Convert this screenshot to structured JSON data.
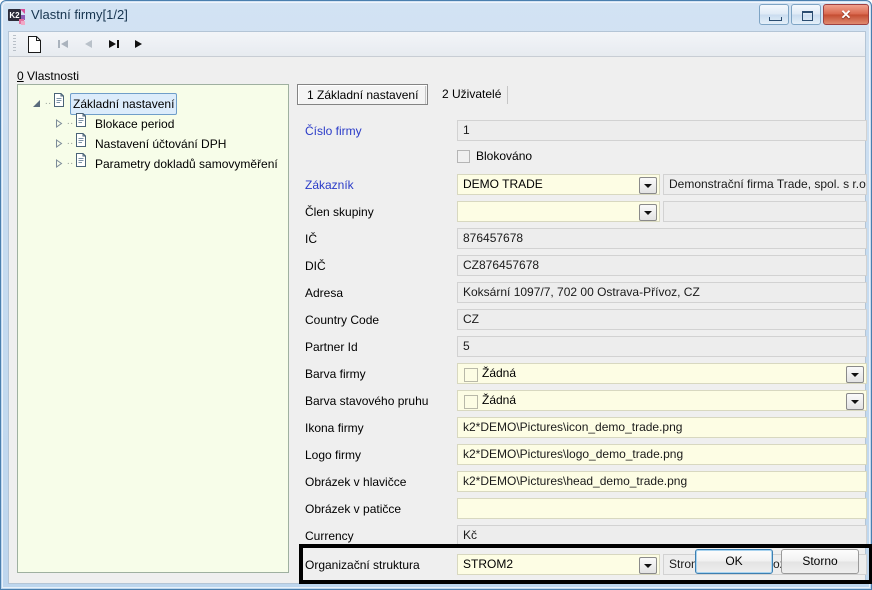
{
  "window": {
    "title": "Vlastní firmy[1/2]",
    "app_icon": "k2-logo-icon",
    "minimize_label": "",
    "maximize_label": "",
    "close_label": "✕"
  },
  "toolbar": {
    "buttons": [
      {
        "name": "new-record-button",
        "icon": "page-icon",
        "enabled": true
      },
      {
        "name": "first-record-button",
        "icon": "skip-back-icon",
        "enabled": false
      },
      {
        "name": "previous-record-button",
        "icon": "triangle-left-icon",
        "enabled": false
      },
      {
        "name": "next-record-button",
        "icon": "skip-forward-icon",
        "enabled": true
      },
      {
        "name": "play-button",
        "icon": "triangle-right-icon",
        "enabled": true
      }
    ]
  },
  "sidebar": {
    "header_accel": "0",
    "header_label": "Vlastnosti",
    "tree": [
      {
        "label": "Základní nastavení",
        "level": 0,
        "expanded": true,
        "selected": true
      },
      {
        "label": "Blokace period",
        "level": 1,
        "expanded": false,
        "selected": false
      },
      {
        "label": "Nastavení účtování DPH",
        "level": 1,
        "expanded": false,
        "selected": false
      },
      {
        "label": "Parametry dokladů samovyměření",
        "level": 1,
        "expanded": false,
        "selected": false
      }
    ]
  },
  "tabs": [
    {
      "label": "1 Základní nastavení",
      "active": true
    },
    {
      "label": "2 Uživatelé",
      "active": false
    }
  ],
  "form": {
    "rows": {
      "cislo_firmy": {
        "label": "Číslo firmy",
        "value": "1"
      },
      "blokovano": {
        "label": "Blokováno",
        "checked": false
      },
      "zakaznik": {
        "label": "Zákazník",
        "value": "DEMO TRADE",
        "description": "Demonstrační firma Trade, spol. s r.o."
      },
      "clen_skupiny": {
        "label": "Člen skupiny",
        "value": "",
        "description": ""
      },
      "ic": {
        "label": "IČ",
        "value": "876457678"
      },
      "dic": {
        "label": "DIČ",
        "value": "CZ876457678"
      },
      "adresa": {
        "label": "Adresa",
        "value": "Koksární 1097/7, 702 00  Ostrava-Přívoz, CZ"
      },
      "country_code": {
        "label": "Country Code",
        "value": "CZ"
      },
      "partner_id": {
        "label": "Partner Id",
        "value": "5"
      },
      "barva_firmy": {
        "label": "Barva firmy",
        "value": "Žádná"
      },
      "barva_stavoveho_pruhu": {
        "label": "Barva stavového pruhu",
        "value": "Žádná"
      },
      "ikona_firmy": {
        "label": "Ikona firmy",
        "value": "k2*DEMO\\Pictures\\icon_demo_trade.png"
      },
      "logo_firmy": {
        "label": "Logo firmy",
        "value": "k2*DEMO\\Pictures\\logo_demo_trade.png"
      },
      "obrazek_v_hlavicce": {
        "label": "Obrázek v hlavičce",
        "value": "k2*DEMO\\Pictures\\head_demo_trade.png"
      },
      "obrazek_v_paticce": {
        "label": "Obrázek v patičce",
        "value": ""
      },
      "currency": {
        "label": "Currency",
        "value": "Kč"
      },
      "organizacni_struktura": {
        "label": "Organizační struktura",
        "value": "STROM2",
        "description": "Strom pracovních pozic",
        "highlighted": true
      }
    }
  },
  "footer": {
    "ok_label": "OK",
    "cancel_label": "Storno"
  },
  "colors": {
    "label_accent": "#2a3bc8",
    "edit_field": "#fdfde4",
    "readonly_field": "#ededed",
    "tree_panel": "#f7fde9",
    "highlight": "#000000",
    "window_frame": "#bdd6ee"
  }
}
